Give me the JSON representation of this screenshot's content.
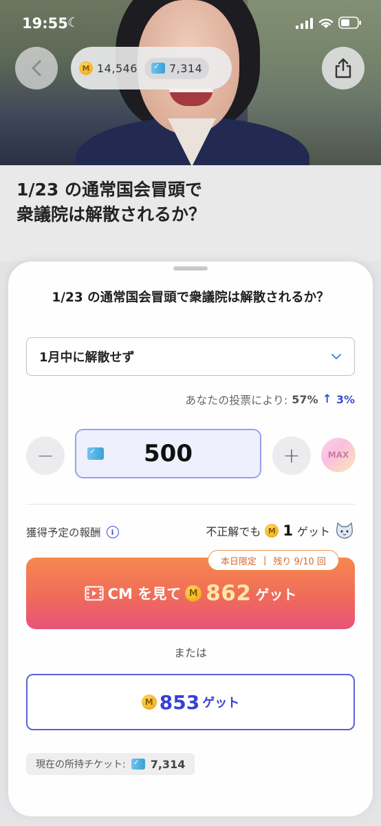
{
  "status_bar": {
    "time": "19:55"
  },
  "header": {
    "coins": "14,546",
    "tickets": "7,314"
  },
  "article": {
    "title_line1": "1/23 の通常国会冒頭で",
    "title_line2": "衆議院は解散されるか？"
  },
  "sheet": {
    "title": "1/23 の通常国会冒頭で衆議院は解散されるか？",
    "selected_option": "1月中に解散せず",
    "vote_effect_label": "あなたの投票により:",
    "vote_effect_pct": "57%",
    "vote_effect_arrow": "↑",
    "vote_effect_delta": "3%",
    "stepper": {
      "value": "500",
      "minus": "−",
      "plus": "+",
      "max": "MAX"
    },
    "reward_label": "獲得予定の報酬",
    "consolation_prefix": "不正解でも",
    "consolation_amount": "1",
    "consolation_suffix": "ゲット",
    "cm_badge_left": "本日限定",
    "cm_badge_sep": "|",
    "cm_badge_right": "残り 9/10 回",
    "cm_button_label": "CM を見て",
    "cm_button_amount": "862",
    "cm_button_suffix": "ゲット",
    "or_text": "または",
    "alt_button_amount": "853",
    "alt_button_suffix": "ゲット",
    "ticket_chip_label": "現在の所持チケット:",
    "ticket_chip_value": "7,314"
  },
  "colors": {
    "accent_blue": "#3c4fd8",
    "cm_gradient_start": "#f7884f",
    "cm_gradient_end": "#e8527a",
    "coin_gold": "#f2b21a"
  }
}
